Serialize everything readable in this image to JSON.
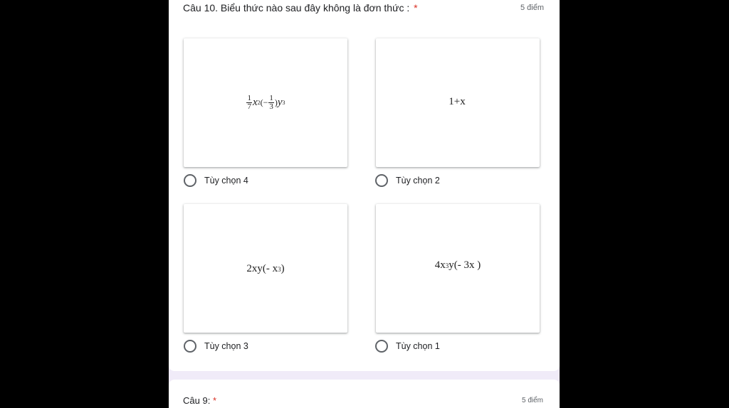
{
  "question": {
    "title": "Câu 10. Biểu thức nào sau đây không là đơn thức :",
    "required_mark": "*",
    "points": "5 điểm"
  },
  "options": [
    {
      "label": "Tùy chọn 4"
    },
    {
      "label": "Tùy chọn 2"
    },
    {
      "label": "Tùy chọn 3"
    },
    {
      "label": "Tùy chọn 1"
    }
  ],
  "formulas": {
    "f1": {
      "coef_num": "1",
      "coef_den": "7",
      "x": "x",
      "x_exp": "2",
      "open": "(−",
      "inner_num": "1",
      "inner_den": "3",
      "close": ")",
      "y": "y",
      "y_exp": "3"
    },
    "f2": {
      "text": "1+x"
    },
    "f3": {
      "base": "2xy(- x",
      "exp": "3",
      "close": " )"
    },
    "f4": {
      "a": "4x",
      "a_exp": "3",
      "b": "y(- 3x )"
    }
  },
  "next_question": {
    "title": "Câu 9:",
    "required_mark": "*",
    "points": "5 điểm"
  }
}
